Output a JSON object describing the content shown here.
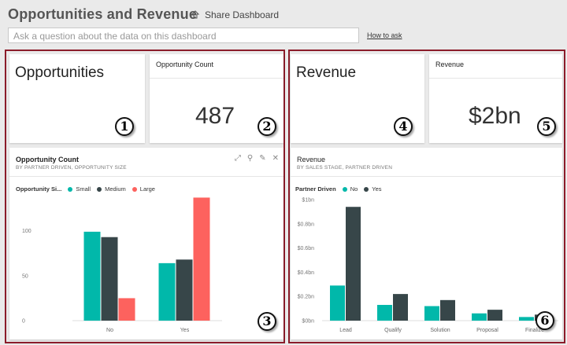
{
  "header": {
    "title": "Opportunities and Revenue",
    "share_label": "Share Dashboard",
    "qa_placeholder": "Ask a question about the data on this dashboard",
    "how_to_ask": "How to ask"
  },
  "tiles": {
    "opportunities_title": "Opportunities",
    "opportunity_count": {
      "title": "Opportunity Count",
      "value": "487"
    },
    "revenue_title": "Revenue",
    "revenue_card": {
      "title": "Revenue",
      "value": "$2bn"
    }
  },
  "badges": [
    "1",
    "2",
    "3",
    "4",
    "5",
    "6"
  ],
  "colors": {
    "teal": "#01b8aa",
    "dark": "#374649",
    "red": "#fd625e",
    "accent": "#8b1c2a"
  },
  "chart_data": [
    {
      "type": "bar",
      "title": "Opportunity Count",
      "subtitle": "BY PARTNER DRIVEN, OPPORTUNITY SIZE",
      "legend_title": "Opportunity Si...",
      "categories": [
        "No",
        "Yes"
      ],
      "series": [
        {
          "name": "Small",
          "color": "#01b8aa",
          "values": [
            99,
            64
          ]
        },
        {
          "name": "Medium",
          "color": "#374649",
          "values": [
            93,
            68
          ]
        },
        {
          "name": "Large",
          "color": "#fd625e",
          "values": [
            25,
            137
          ]
        }
      ],
      "yticks": [
        "100",
        "50",
        "0"
      ],
      "ylim": [
        0,
        140
      ]
    },
    {
      "type": "bar",
      "title": "Revenue",
      "subtitle": "BY SALES STAGE, PARTNER DRIVEN",
      "legend_title": "Partner Driven",
      "categories": [
        "Lead",
        "Qualify",
        "Solution",
        "Proposal",
        "Finalize"
      ],
      "series": [
        {
          "name": "No",
          "color": "#01b8aa",
          "values": [
            0.29,
            0.13,
            0.12,
            0.06,
            0.03
          ]
        },
        {
          "name": "Yes",
          "color": "#374649",
          "values": [
            0.94,
            0.22,
            0.17,
            0.09,
            0.05
          ]
        }
      ],
      "yticks": [
        "$1bn",
        "$0.8bn",
        "$0.6bn",
        "$0.4bn",
        "$0.2bn",
        "$0bn"
      ],
      "ylim": [
        0,
        1.0
      ]
    }
  ]
}
